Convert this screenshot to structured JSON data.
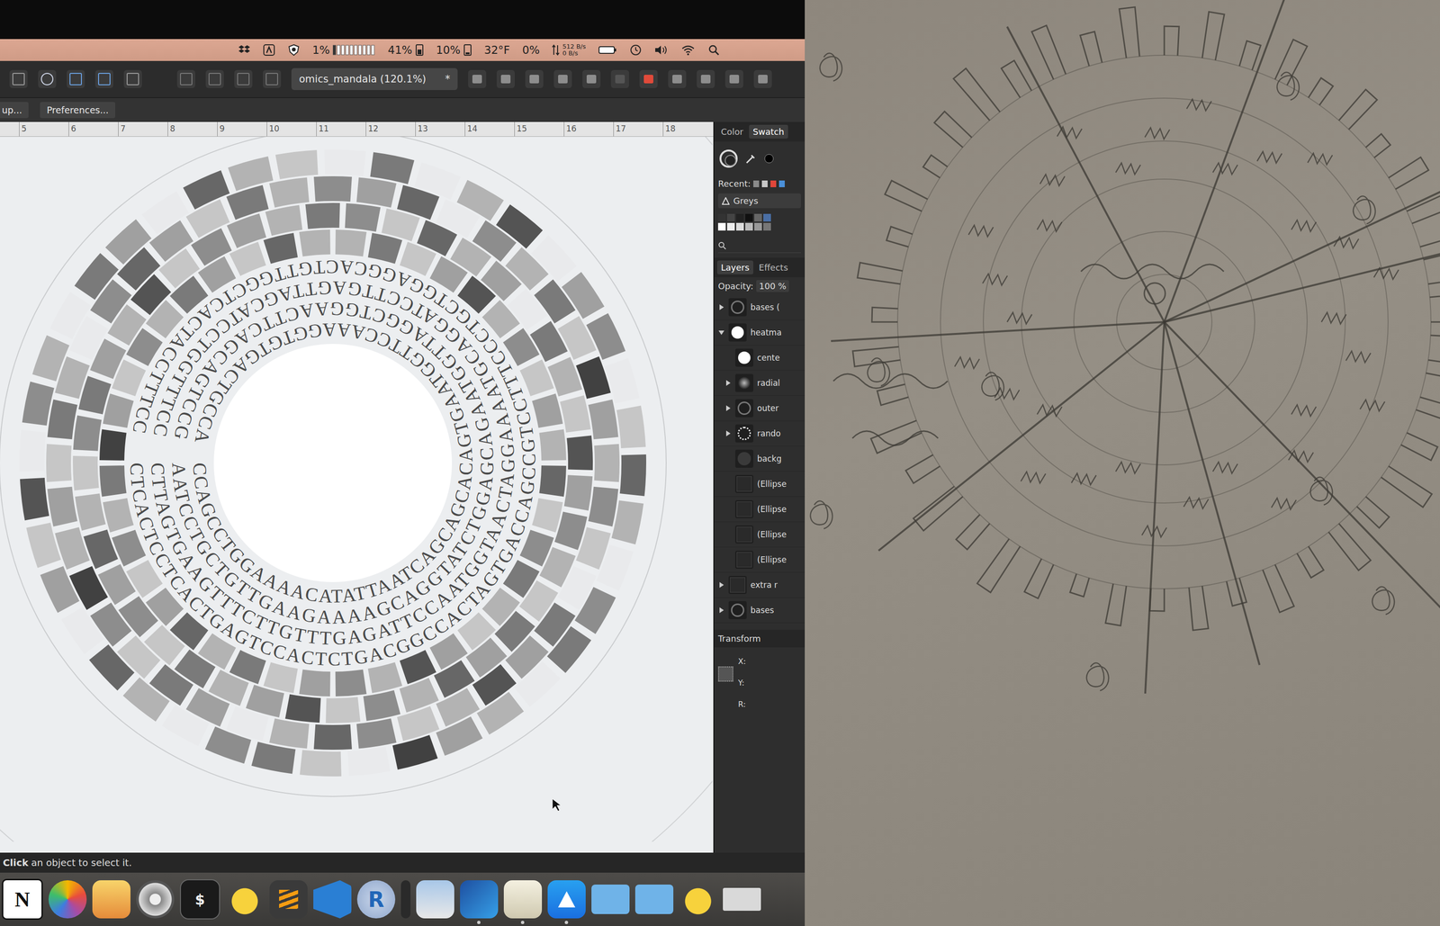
{
  "menu_bar": {
    "stats": [
      {
        "text": "1%",
        "kind": "cpu"
      },
      {
        "text": "41%",
        "kind": "memory"
      },
      {
        "text": "10%",
        "kind": "disk"
      },
      {
        "text": "32°F",
        "kind": "plain"
      },
      {
        "text": "0%",
        "kind": "plain"
      }
    ],
    "network": [
      "512 B/s",
      "0 B/s"
    ]
  },
  "toolbar": {
    "document_tab": {
      "title": "omics_mandala (120.1%)",
      "modified": "*"
    }
  },
  "context_bar": {
    "buttons": [
      "up...",
      "Preferences..."
    ]
  },
  "ruler": {
    "ticks": [
      "5",
      "6",
      "7",
      "8",
      "9",
      "10",
      "11",
      "12",
      "13",
      "14",
      "15",
      "16",
      "17",
      "18"
    ]
  },
  "mandala": {
    "sequence_rings": [
      "CTCACTCCTCACTGAGTCCACTCTGACGGCCACTAGTGACCAGCCGTCCTTTCCCTGCTGGAGGCACTGTTGGCTCACTACCTTTCC",
      "CTTAGTGAAGTTTCTTGTTTGAGATTCCAATGGTAACTAGGAAAATGCAGGATCCTTGAGTTAGCATCCTGGTTTCC",
      "AATCCTGCTGTTGAAGAAAAGCAGGTATCTGGAGCAGAATGGTTAGGCTGGAACTTCAGCAGTCCG",
      "CCAGCCTGGAAAACATATTAATCAGCAGCACAGTGAATGGTTCCAAAGGTGTGACTGCCA"
    ],
    "heatmap_rings": [
      [
        0.3,
        0.6,
        0.2,
        0.4,
        0.8,
        0.3,
        0.5,
        0.2,
        0.4,
        0.3,
        0.7,
        0.2,
        0.5,
        0.6,
        0.3,
        0.2,
        0.4,
        0.8,
        0.3,
        0.5,
        0.4,
        0.2,
        0.6,
        0.3,
        0.7,
        0.4,
        0.2,
        0.5,
        0.3,
        0.6,
        0.9,
        0.4,
        0.2,
        0.5,
        0.3,
        0.6,
        0.4,
        0.2,
        0.7,
        0.3
      ],
      [
        0.5,
        0.2,
        0.7,
        0.3,
        0.4,
        0,
        0.6,
        0.3,
        0.2,
        0.8,
        0.4,
        0.5,
        0.3,
        0.2,
        0.6,
        0.4,
        0.7,
        0.3,
        0.5,
        0.2,
        0.8,
        0.4,
        0.3,
        0.6,
        0.2,
        0.5,
        0.4,
        0.7,
        0.3,
        0.2,
        0.5,
        0.6,
        0.4,
        0.3,
        0.8,
        0.2,
        0.5,
        0.4,
        0.3,
        0.6
      ],
      [
        0.4,
        0.7,
        0,
        0.5,
        0.3,
        0.6,
        0.2,
        0.9,
        0.4,
        0.3,
        0.5,
        0.2,
        0,
        0.6,
        0.4,
        0.8,
        0.3,
        0.2,
        0.5,
        0.7,
        0.3,
        0,
        0.4,
        0.6,
        0.2,
        0.5,
        0.9,
        0.3,
        0.4,
        0.2,
        0.6,
        0.3,
        0,
        0.5,
        0.7,
        0.4,
        0.2,
        0.6,
        0.3,
        0.5
      ],
      [
        0.6,
        0,
        0.3,
        0.8,
        0,
        0.4,
        0.5,
        0,
        0.2,
        0.7,
        0.3,
        0,
        0.5,
        0.6,
        0,
        0.3,
        0.4,
        0.9,
        0,
        0.2,
        0.6,
        0.5,
        0,
        0.3,
        0.7,
        0,
        0.4,
        0.2,
        0.8,
        0,
        0.5,
        0.3,
        0,
        0.6,
        0.4,
        0,
        0.7,
        0.3,
        0.2,
        0
      ]
    ]
  },
  "panel": {
    "tabs": [
      {
        "label": "Color",
        "selected": false
      },
      {
        "label": "Swatch",
        "selected": true
      }
    ],
    "recent_label": "Recent:",
    "recent_colors": [
      {
        "color": "#8a8a8a"
      },
      {
        "color": "#c8c8c8"
      },
      {
        "color": "#e0463a"
      },
      {
        "color": "#4a90d9"
      }
    ],
    "palette": "Greys",
    "layer_tabs": [
      {
        "label": "Layers",
        "selected": true
      },
      {
        "label": "Effects",
        "selected": false
      }
    ],
    "opacity_label": "Opacity:",
    "opacity": "100 %",
    "layers": [
      {
        "name": "bases (",
        "depth": 0,
        "expandable": true,
        "expanded": false,
        "kind": "ring"
      },
      {
        "name": "heatma",
        "depth": 0,
        "expandable": true,
        "expanded": true,
        "kind": "white"
      },
      {
        "name": "cente",
        "depth": 1,
        "expandable": false,
        "kind": "white"
      },
      {
        "name": "radial",
        "depth": 1,
        "expandable": true,
        "expanded": false,
        "kind": "glow"
      },
      {
        "name": "outer",
        "depth": 1,
        "expandable": true,
        "expanded": false,
        "kind": "ring"
      },
      {
        "name": "rando",
        "depth": 1,
        "expandable": true,
        "expanded": false,
        "kind": "dotted"
      },
      {
        "name": "backg",
        "depth": 1,
        "expandable": false,
        "kind": "dark"
      },
      {
        "name": "(Ellipse",
        "depth": 1,
        "expandable": false,
        "kind": "square"
      },
      {
        "name": "(Ellipse",
        "depth": 1,
        "expandable": false,
        "kind": "square"
      },
      {
        "name": "(Ellipse",
        "depth": 1,
        "expandable": false,
        "kind": "square"
      },
      {
        "name": "(Ellipse",
        "depth": 1,
        "expandable": false,
        "kind": "square"
      },
      {
        "name": "extra r",
        "depth": 0,
        "expandable": true,
        "expanded": false,
        "kind": "square"
      },
      {
        "name": "bases",
        "depth": 0,
        "expandable": true,
        "expanded": false,
        "kind": "ring"
      }
    ],
    "transform": {
      "title": "Transform",
      "fields": [
        "X:",
        "Y:",
        "R:"
      ]
    }
  },
  "status_bar": {
    "action": "Click",
    "hint": "an object to select it."
  },
  "dock": {
    "items": [
      {
        "kind": "notion",
        "label": "N",
        "running": false
      },
      {
        "kind": "photos",
        "running": false
      },
      {
        "kind": "music",
        "running": false
      },
      {
        "kind": "disk",
        "running": false
      },
      {
        "kind": "terminal",
        "label": "$",
        "running": false
      },
      {
        "kind": "duck",
        "running": false
      },
      {
        "kind": "sublime",
        "running": false
      },
      {
        "kind": "vscode",
        "running": false
      },
      {
        "kind": "r",
        "label": "R",
        "running": false
      },
      {
        "kind": "bar",
        "running": false
      },
      {
        "kind": "preview",
        "running": false
      },
      {
        "kind": "designer",
        "running": true
      },
      {
        "kind": "textedit",
        "running": true
      },
      {
        "kind": "appstore",
        "running": true
      },
      {
        "kind": "folder",
        "running": false
      },
      {
        "kind": "downloads",
        "running": false
      },
      {
        "kind": "duck",
        "running": false
      },
      {
        "kind": "window",
        "running": false
      }
    ]
  }
}
